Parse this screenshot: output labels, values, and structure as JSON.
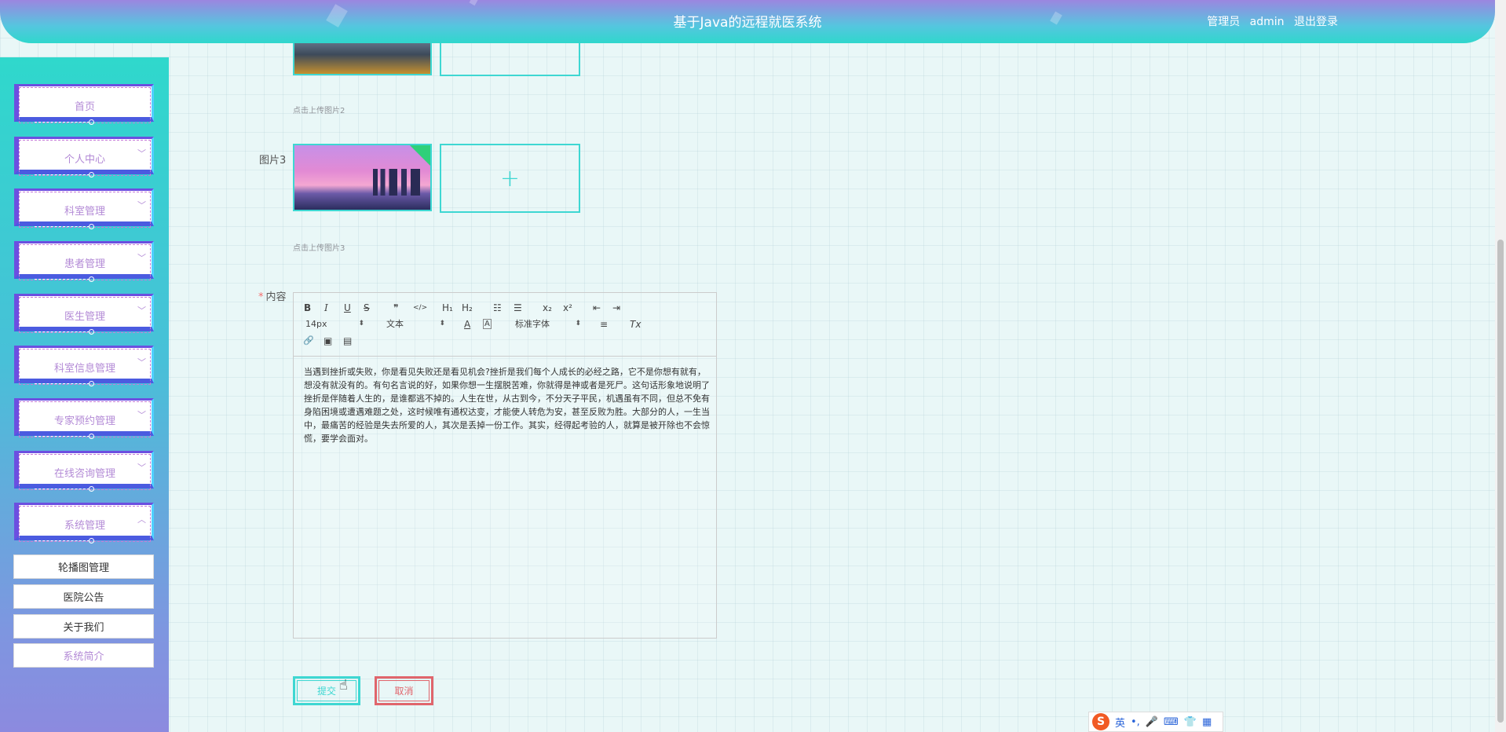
{
  "header": {
    "title": "基于Java的远程就医系统",
    "role": "管理员",
    "username": "admin",
    "logout_label": "退出登录"
  },
  "sidebar": {
    "items": [
      {
        "label": "首页",
        "has_arrow": false
      },
      {
        "label": "个人中心",
        "has_arrow": true
      },
      {
        "label": "科室管理",
        "has_arrow": true
      },
      {
        "label": "患者管理",
        "has_arrow": true
      },
      {
        "label": "医生管理",
        "has_arrow": true
      },
      {
        "label": "科室信息管理",
        "has_arrow": true
      },
      {
        "label": "专家预约管理",
        "has_arrow": true
      },
      {
        "label": "在线咨询管理",
        "has_arrow": true
      },
      {
        "label": "系统管理",
        "has_arrow": true,
        "expanded": true
      }
    ],
    "sub_items": [
      {
        "label": "轮播图管理"
      },
      {
        "label": "医院公告"
      },
      {
        "label": "关于我们"
      },
      {
        "label": "系统简介",
        "active": true
      }
    ]
  },
  "form": {
    "image2_hint": "点击上传图片2",
    "image3_label": "图片3",
    "image3_hint": "点击上传图片3",
    "upload_plus": "+",
    "content_label": "内容",
    "required_mark": "*",
    "editor": {
      "toolbar": {
        "bold": "B",
        "italic": "I",
        "underline": "U",
        "strike": "S",
        "quote": "❞",
        "code": "</>",
        "h1": "H₁",
        "h2": "H₂",
        "ordered_list": "☷",
        "bullet_list": "☰",
        "subscript": "x₂",
        "superscript": "x²",
        "outdent": "⇤",
        "indent": "⇥",
        "font_size": "14px",
        "header_select": "文本",
        "color": "A",
        "background": "A",
        "font_family": "标准字体",
        "align": "≡",
        "clean": "Tx",
        "link": "🔗",
        "image": "▣",
        "video": "▤"
      },
      "content": "当遇到挫折或失败，你是看见失败还是看见机会?挫折是我们每个人成长的必经之路，它不是你想有就有，想没有就没有的。有句名言说的好，如果你想一生摆脱苦难，你就得是神或者是死尸。这句话形象地说明了挫折是伴随着人生的，是谁都逃不掉的。人生在世，从古到今，不分天子平民，机遇虽有不同，但总不免有身陷困境或遭遇难题之处，这时候唯有通权达变，才能使人转危为安，甚至反败为胜。大部分的人，一生当中，最痛苦的经验是失去所爱的人，其次是丢掉一份工作。其实，经得起考验的人，就算是被开除也不会惊慌，要学会面对。"
    },
    "submit_label": "提交",
    "cancel_label": "取消"
  },
  "ime": {
    "logo": "S",
    "mode": "英",
    "punct": "•,",
    "mic": "🎤",
    "keyboard": "⌨",
    "skin": "👕",
    "apps": "▦"
  },
  "colors": {
    "accent": "#3ed7d2",
    "menu_text": "#b38ad6",
    "cancel": "#e0656c",
    "required": "#f56c6c"
  }
}
